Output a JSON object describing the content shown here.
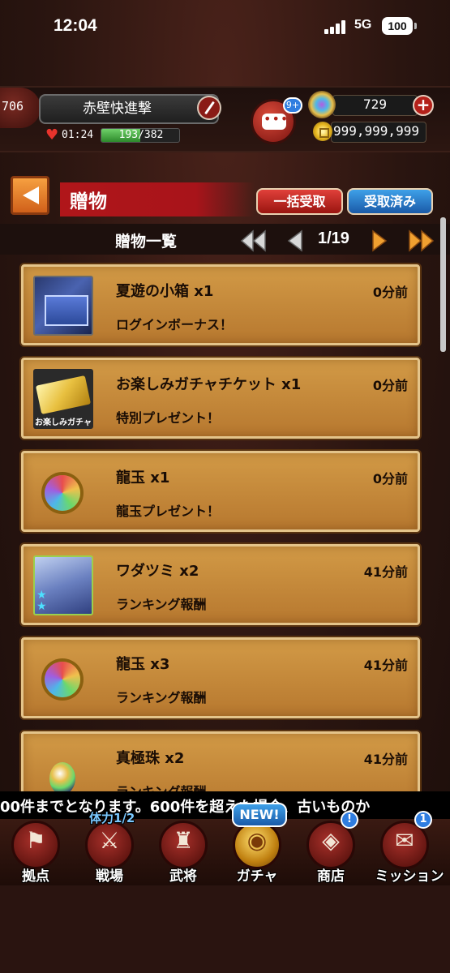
{
  "status_bar": {
    "time": "12:04",
    "network": "5G",
    "battery": "100"
  },
  "player": {
    "level": "706",
    "name": "赤壁快進撃",
    "stamina_timer": "01:24",
    "stamina": "193/382",
    "stamina_fraction": 0.505
  },
  "chat": {
    "badge": "9+"
  },
  "currency": {
    "gems": "729",
    "gold": "999,999,999"
  },
  "title": {
    "label": "贈物",
    "bulk_button": "一括受取",
    "received_button": "受取済み"
  },
  "list_header": {
    "title": "贈物一覧",
    "page": "1/19"
  },
  "gifts": [
    {
      "name": "夏遊の小箱 x1",
      "time": "0分前",
      "desc": "ログインボーナス！",
      "icon": "chest-icon"
    },
    {
      "name": "お楽しみガチャチケット x1",
      "time": "0分前",
      "desc": "特別プレゼント！",
      "icon": "ticket-icon",
      "icon_label": "お楽しみガチャ"
    },
    {
      "name": "龍玉 x1",
      "time": "0分前",
      "desc": "龍玉プレゼント！",
      "icon": "dragon-orb-icon"
    },
    {
      "name": "ワダツミ x2",
      "time": "41分前",
      "desc": "ランキング報酬",
      "icon": "character-icon"
    },
    {
      "name": "龍玉 x3",
      "time": "41分前",
      "desc": "ランキング報酬",
      "icon": "dragon-orb-icon"
    },
    {
      "name": "真極珠 x2",
      "time": "41分前",
      "desc": "ランキング報酬",
      "icon": "pearl-icon"
    }
  ],
  "marquee": "00件までとなります。600件を超えた場合、古いものか",
  "bottom_nav": {
    "items": [
      {
        "label": "拠点",
        "icon": "flag-icon"
      },
      {
        "label": "戦場",
        "icon": "crossed-swords-icon",
        "tag": "体力1/2"
      },
      {
        "label": "武将",
        "icon": "helmet-icon"
      },
      {
        "label": "ガチャ",
        "icon": "gacha-icon",
        "badge": "NEW!"
      },
      {
        "label": "商店",
        "icon": "shop-dragon-icon",
        "badge": "!"
      },
      {
        "label": "ミッション",
        "icon": "scroll-icon",
        "badge": "1"
      }
    ]
  }
}
